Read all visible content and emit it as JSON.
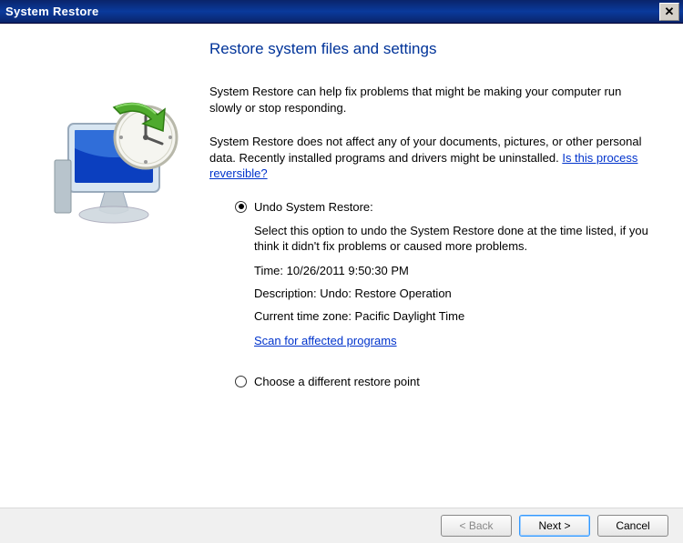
{
  "titlebar": {
    "title": "System Restore"
  },
  "heading": "Restore system files and settings",
  "intro1": "System Restore can help fix problems that might be making your computer run slowly or stop responding.",
  "intro2": "System Restore does not affect any of your documents, pictures, or other personal data. Recently installed programs and drivers might be uninstalled. ",
  "reversible_link": "Is this process reversible?",
  "options": {
    "undo": {
      "label": "Undo System Restore:",
      "desc": "Select this option to undo the System Restore done at the time listed, if you think it didn't fix problems or caused more problems.",
      "time_label": "Time: ",
      "time_value": "10/26/2011 9:50:30 PM",
      "desc_label": "Description: ",
      "desc_value": "Undo: Restore Operation",
      "tz_label": "Current time zone: ",
      "tz_value": "Pacific Daylight Time",
      "scan_link": "Scan for affected programs"
    },
    "choose": {
      "label": "Choose a different restore point"
    }
  },
  "buttons": {
    "back": "< Back",
    "next": "Next >",
    "cancel": "Cancel"
  }
}
